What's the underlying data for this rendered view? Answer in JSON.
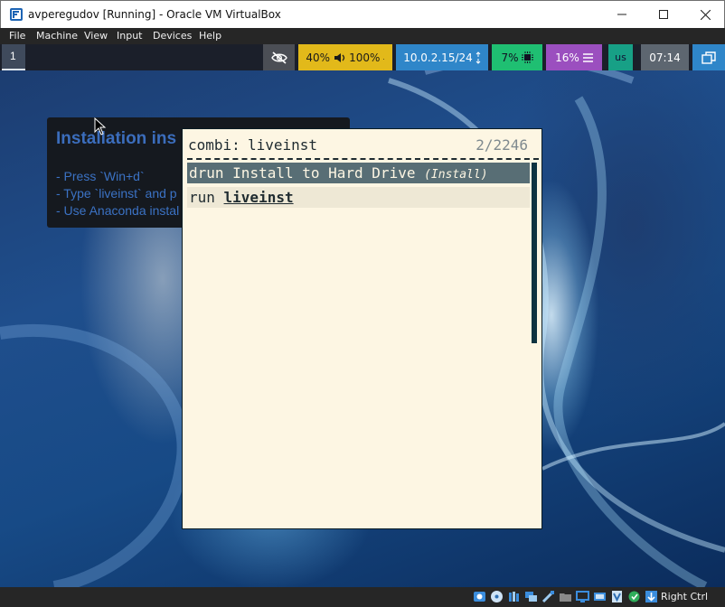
{
  "window": {
    "title": "avperegudov [Running] - Oracle VM VirtualBox"
  },
  "menubar": {
    "items": [
      "File",
      "Machine",
      "View",
      "Input",
      "Devices",
      "Help"
    ]
  },
  "topbar": {
    "workspace": "1",
    "audio": {
      "value1": "40%",
      "value2": "100%"
    },
    "network": {
      "ip": "10.0.2.15/24"
    },
    "cpu": "7%",
    "memory": "16%",
    "keyboard_layout": "us",
    "clock": "07:14"
  },
  "tip": {
    "title": "Installation ins",
    "lines": [
      "- Press `Win+d`",
      "- Type `liveinst` and p",
      "- Use Anaconda instal"
    ]
  },
  "rofi": {
    "prompt": "combi:",
    "query": "liveinst",
    "count": "2/2246",
    "rows": [
      {
        "prefix": "drun",
        "text": "Install to Hard Drive",
        "hint": "(Install)"
      },
      {
        "prefix": "run",
        "match": "liveinst"
      }
    ]
  },
  "statusbar": {
    "host_key": "Right Ctrl",
    "icons": [
      "hard-disk-icon",
      "optical-disk-icon",
      "audio-icon",
      "network-icon",
      "usb-icon",
      "shared-folders-icon",
      "display-icon",
      "video-capture-icon",
      "guest-additions-icon",
      "mouse-integration-icon",
      "keyboard-capture-icon"
    ]
  },
  "colors": {
    "audio": "#e2b91a",
    "network": "#2f86c9",
    "cpu": "#1fbf72",
    "memory": "#9b4fbf",
    "keyboard": "#17a086",
    "clock": "#5d6670",
    "rofi_bg": "#fdf6e3",
    "rofi_selected": "#586e75"
  }
}
